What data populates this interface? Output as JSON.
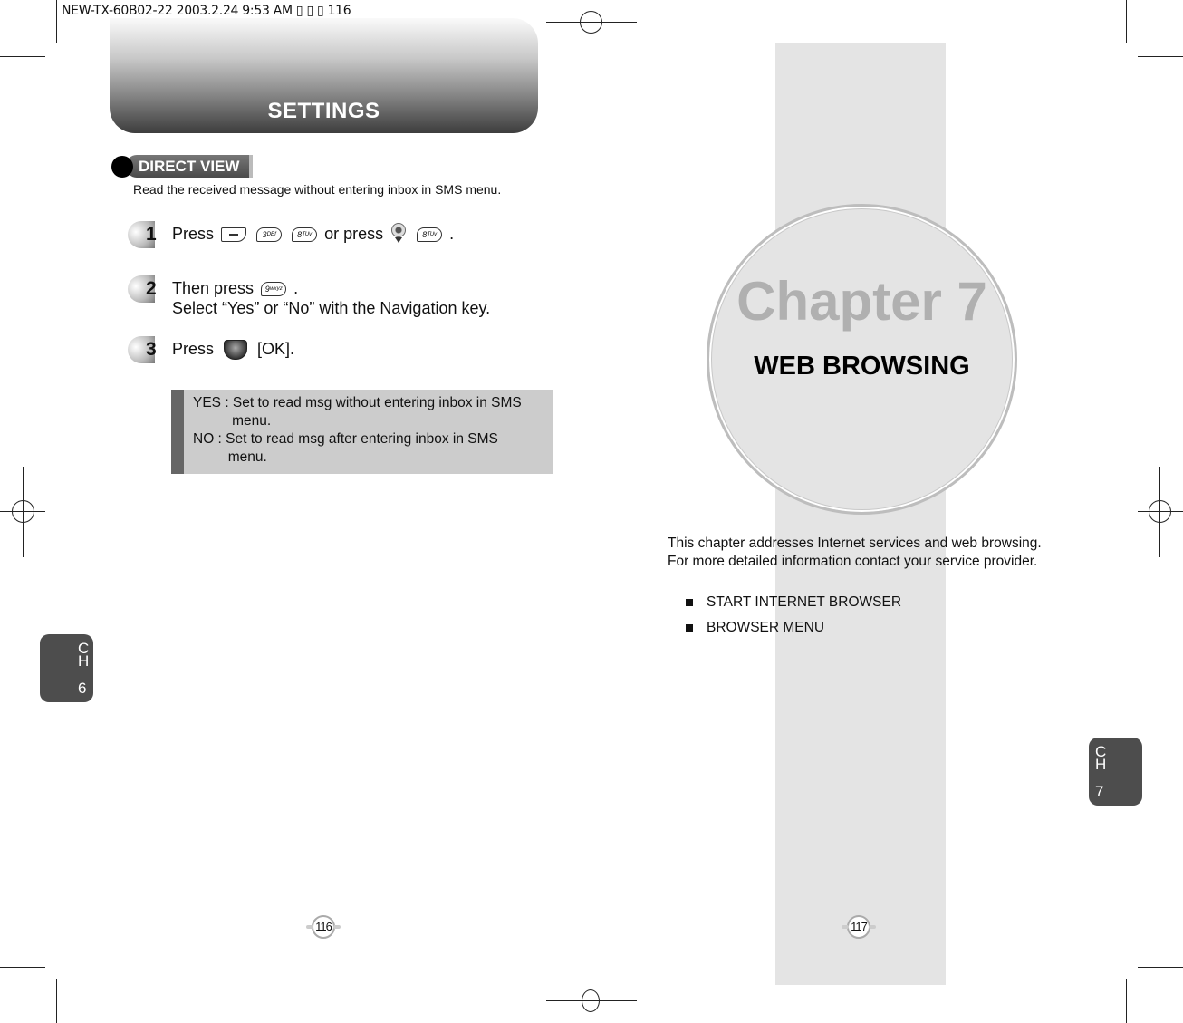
{
  "slug": "NEW-TX-60B02-22  2003.2.24 9:53 AM  ▯ ▯ ▯ 116",
  "left_page": {
    "header_title": "SETTINGS",
    "section_title": "DIRECT VIEW",
    "description": "Read the received message without entering inbox in SMS menu.",
    "steps": [
      {
        "number": "1",
        "prefix": "Press",
        "keys": [
          "softkey",
          "3DEF",
          "8TUV"
        ],
        "middle": "or press",
        "keys2": [
          "nav-down",
          "8TUV"
        ],
        "suffix": "."
      },
      {
        "number": "2",
        "line1_prefix": "Then press",
        "key": "9WXYZ",
        "line1_suffix": ".",
        "line2": "Select “Yes” or “No” with the Navigation key."
      },
      {
        "number": "3",
        "prefix": "Press",
        "key": "ok-key",
        "suffix": "[OK]."
      }
    ],
    "key_labels": {
      "k3": "3ᴰᴱᶠ",
      "k8": "8ᵀᵁᵛ",
      "k9": "9ʷˣʸᶻ"
    },
    "note": "YES : Set to read msg without entering inbox in SMS\n          menu.\nNO : Set to read msg after entering inbox in SMS\n         menu.",
    "chapter_tab": {
      "ch": [
        "C",
        "H"
      ],
      "num": "6"
    },
    "page_number": "116"
  },
  "right_page": {
    "chapter_label": "Chapter 7",
    "chapter_title": "WEB BROWSING",
    "intro_line1": "This chapter addresses Internet services and web browsing.",
    "intro_line2": "For more detailed information contact your service provider.",
    "bullets": [
      "START INTERNET BROWSER",
      "BROWSER MENU"
    ],
    "chapter_tab": {
      "ch": [
        "C",
        "H"
      ],
      "num": "7"
    },
    "page_number": "117"
  },
  "colors": {
    "banner_dark": "#3d3d3d",
    "grey_column": "#e4e4e4",
    "note_bg": "#cccccc",
    "tab_bg": "#4d4d4d"
  }
}
